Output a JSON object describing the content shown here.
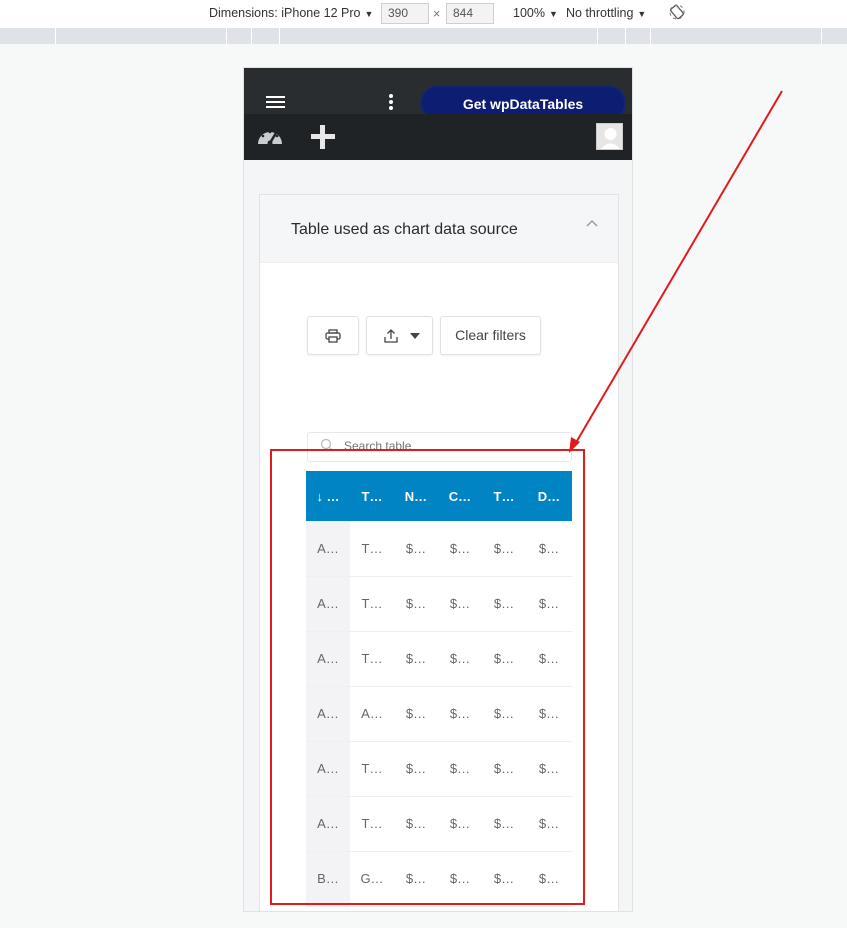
{
  "devtools": {
    "device_label": "Dimensions: iPhone 12 Pro",
    "width_value": "390",
    "times": "×",
    "height_value": "844",
    "zoom": "100%",
    "throttling": "No throttling"
  },
  "header": {
    "cta_label": "Get wpDataTables"
  },
  "panel": {
    "title": "Table used as chart data source",
    "clear_filters_label": "Clear filters",
    "search_placeholder": "Search table"
  },
  "table": {
    "columns": [
      "↓ …",
      "T…",
      "N…",
      "C…",
      "T…",
      "D…"
    ],
    "rows": [
      [
        "A…",
        "T…",
        "$…",
        "$…",
        "$…",
        "$…"
      ],
      [
        "A…",
        "T…",
        "$…",
        "$…",
        "$…",
        "$…"
      ],
      [
        "A…",
        "T…",
        "$…",
        "$…",
        "$…",
        "$…"
      ],
      [
        "A…",
        "A…",
        "$…",
        "$…",
        "$…",
        "$…"
      ],
      [
        "A…",
        "T…",
        "$…",
        "$…",
        "$…",
        "$…"
      ],
      [
        "A…",
        "T…",
        "$…",
        "$…",
        "$…",
        "$…"
      ],
      [
        "B…",
        "G…",
        "$…",
        "$…",
        "$…",
        "$…"
      ]
    ]
  },
  "colors": {
    "table_header": "#0184c3",
    "cta_background": "#0c1d72",
    "annotation_red": "#e01b1b"
  },
  "icons": [
    "hamburger-icon",
    "kebab-icon",
    "dashboard-icon",
    "plus-icon",
    "avatar-icon",
    "chevron-up-icon",
    "print-icon",
    "export-icon",
    "caret-down-icon",
    "search-icon",
    "rotate-icon"
  ]
}
